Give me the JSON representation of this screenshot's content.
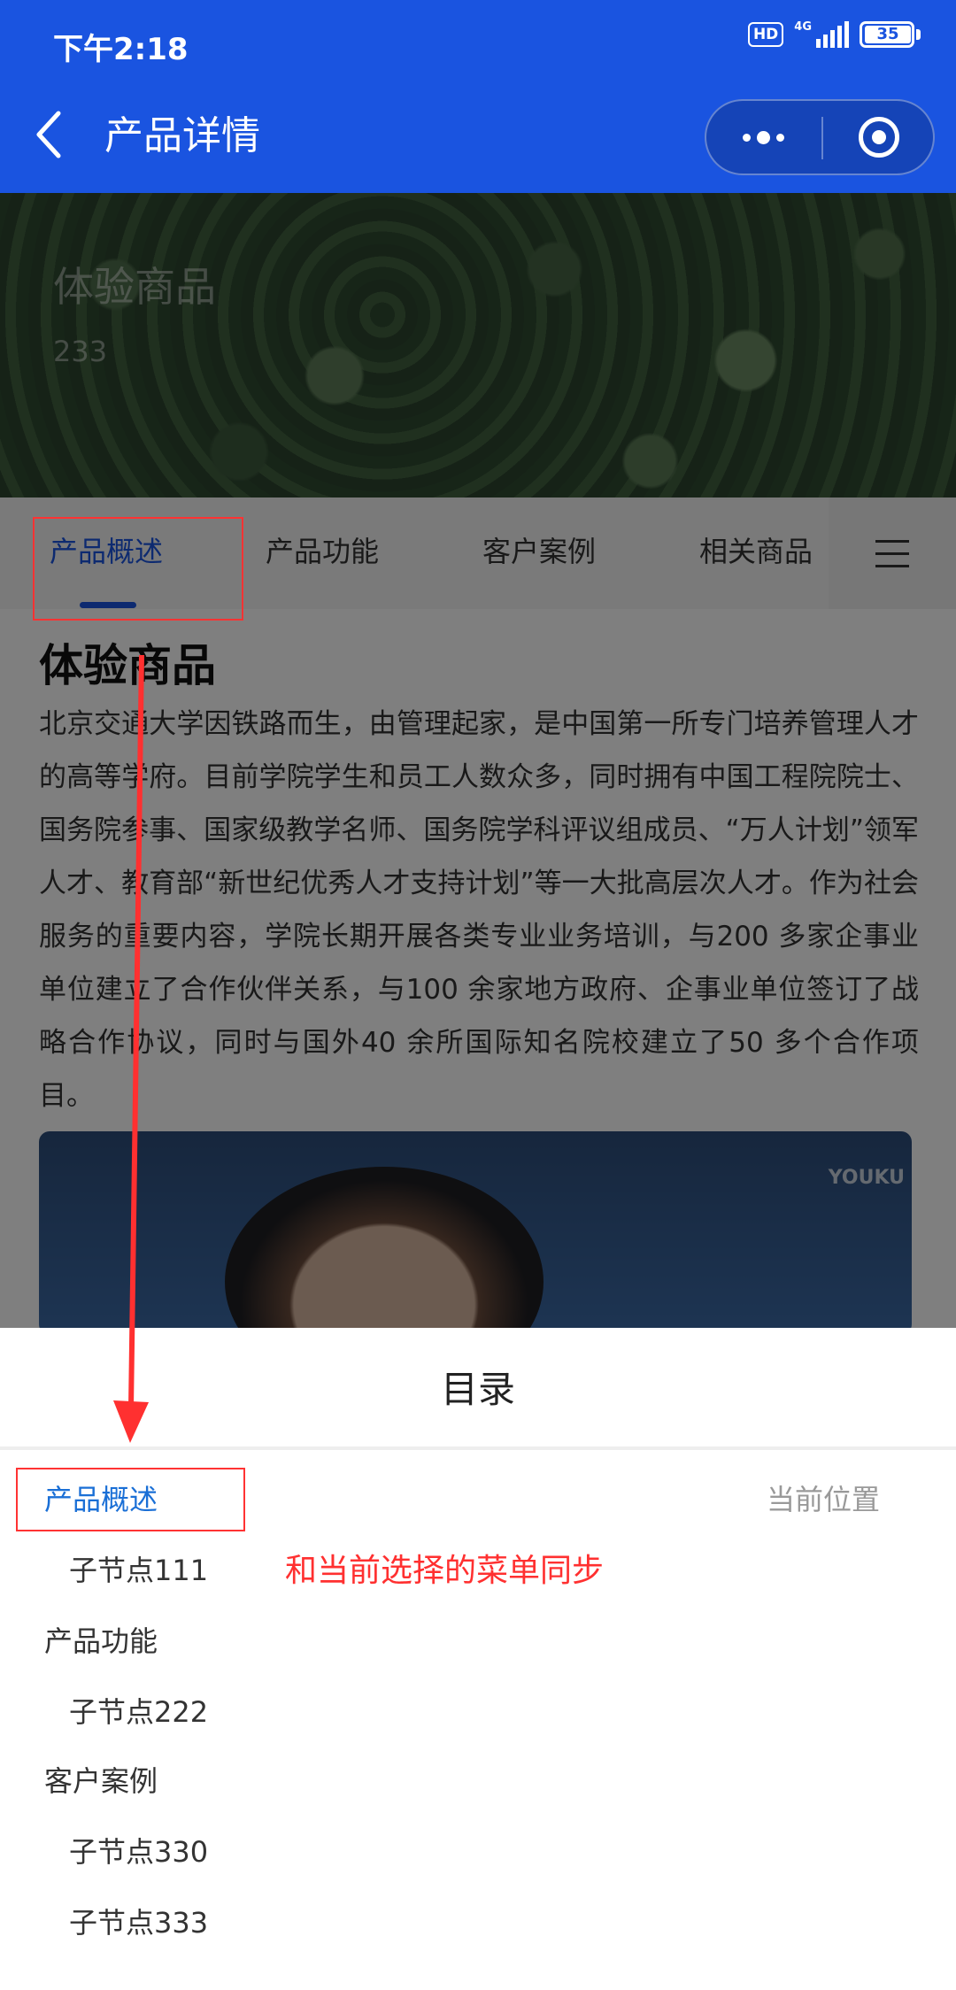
{
  "status_bar": {
    "time": "下午2:18",
    "hd_label": "HD",
    "network_label": "4G",
    "battery_level": "35"
  },
  "nav_bar": {
    "title": "产品详情",
    "icons": {
      "back": "chevron-left-icon",
      "more": "more-dots-icon",
      "close": "target-circle-icon"
    }
  },
  "banner": {
    "title": "体验商品",
    "subtitle": "233"
  },
  "tabs": {
    "items": [
      {
        "label": "产品概述",
        "active": true
      },
      {
        "label": "产品功能",
        "active": false
      },
      {
        "label": "客户案例",
        "active": false
      },
      {
        "label": "相关商品",
        "active": false
      }
    ],
    "menu_icon": "hamburger-menu-icon"
  },
  "content": {
    "title": "体验商品",
    "paragraph": "北京交通大学因铁路而生，由管理起家，是中国第一所专门培养管理人才的高等学府。目前学院学生和员工人数众多，同时拥有中国工程院院士、国务院参事、国家级教学名师、国务院学科评议组成员、“万人计划”领军人才、教育部“新世纪优秀人才支持计划”等一大批高层次人才。作为社会服务的重要内容，学院长期开展各类专业业务培训，与200 多家企事业单位建立了合作伙伴关系，与100 余家地方政府、企事业单位签订了战略合作协议，同时与国外40 余所国际知名院校建立了50 多个合作项目。",
    "video_watermark": "YOUKU"
  },
  "toc": {
    "title": "目录",
    "current_label": "当前位置",
    "items": [
      {
        "label": "产品概述",
        "level": 1,
        "active": true
      },
      {
        "label": "子节点111",
        "level": 2,
        "active": false
      },
      {
        "label": "产品功能",
        "level": 1,
        "active": false
      },
      {
        "label": "子节点222",
        "level": 2,
        "active": false
      },
      {
        "label": "客户案例",
        "level": 1,
        "active": false
      },
      {
        "label": "子节点330",
        "level": 2,
        "active": false
      },
      {
        "label": "子节点333",
        "level": 2,
        "active": false
      }
    ]
  },
  "annotation": {
    "note": "和当前选择的菜单同步",
    "color": "#ff3030"
  },
  "colors": {
    "primary": "#1a54e0",
    "toc_active": "#1a6fd6",
    "annotation": "#ff3030"
  }
}
